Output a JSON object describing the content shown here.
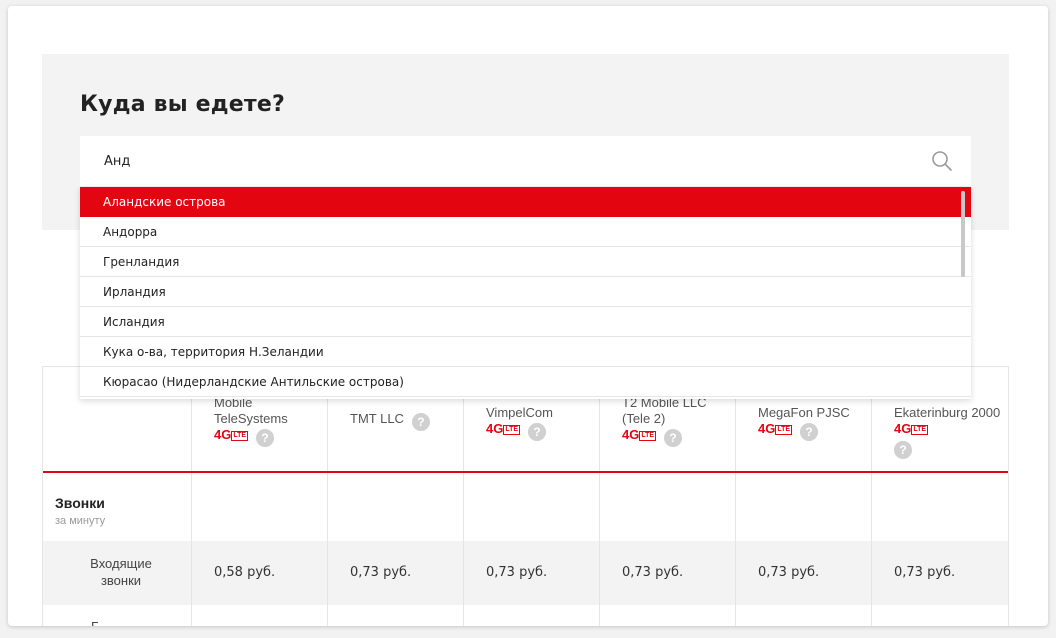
{
  "heading": "Куда вы едете?",
  "search": {
    "value": "Анд",
    "icon": "search-icon"
  },
  "dropdown": {
    "items": [
      "Аландские острова",
      "Андорра",
      "Гренландия",
      "Ирландия",
      "Исландия",
      "Кука о-ва, территория Н.Зеландии",
      "Кюрасао (Нидерландские Антильские острова)"
    ],
    "active_index": 0
  },
  "table": {
    "operators": [
      {
        "name": "Mobile TeleSystems",
        "lte": true
      },
      {
        "name": "TMT LLC",
        "lte": false
      },
      {
        "name": "VimpelCom",
        "lte": true
      },
      {
        "name": "T2 Mobile LLC (Tele 2)",
        "lte": true
      },
      {
        "name": "MegaFon PJSC",
        "lte": true
      },
      {
        "name": "Ekaterinburg 2000",
        "lte": true
      }
    ],
    "lte_label": "4G",
    "lte_badge": "LTE",
    "help_glyph": "?",
    "section": {
      "title": "Звонки",
      "subtitle": "за минуту"
    },
    "rows": [
      {
        "label": "Входящие звонки",
        "values": [
          "0,58 руб.",
          "0,73 руб.",
          "0,73 руб.",
          "0,73 руб.",
          "0,73 руб.",
          "0,73 руб."
        ]
      }
    ],
    "next_row_label": "Б"
  },
  "colors": {
    "accent": "#e30611",
    "panel_bg": "#f3f3f3"
  }
}
